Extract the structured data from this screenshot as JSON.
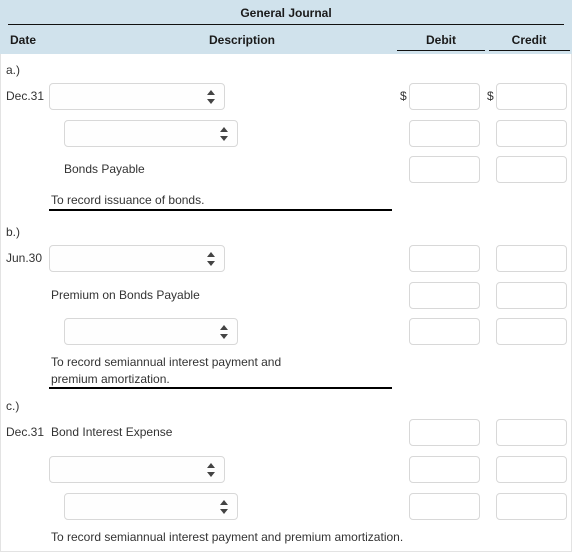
{
  "header": {
    "title": "General Journal",
    "columns": {
      "date": "Date",
      "description": "Description",
      "debit": "Debit",
      "credit": "Credit"
    }
  },
  "currency_symbol": "$",
  "select_placeholder": "",
  "amount_placeholder": "",
  "entries": [
    {
      "label": "a.)",
      "date": "Dec.31",
      "lines": [
        {
          "kind": "select",
          "value": "",
          "indent": 0,
          "debit": "",
          "credit": "",
          "show_currency": true
        },
        {
          "kind": "select",
          "value": "",
          "indent": 1,
          "debit": "",
          "credit": "",
          "show_currency": false
        },
        {
          "kind": "text",
          "value": "Bonds Payable",
          "indent": 1,
          "debit": "",
          "credit": "",
          "show_currency": false
        }
      ],
      "memo": "To record issuance of bonds."
    },
    {
      "label": "b.)",
      "date": "Jun.30",
      "lines": [
        {
          "kind": "select",
          "value": "",
          "indent": 0,
          "debit": "",
          "credit": "",
          "show_currency": false
        },
        {
          "kind": "text",
          "value": "Premium on Bonds Payable",
          "indent": 0,
          "debit": "",
          "credit": "",
          "show_currency": false
        },
        {
          "kind": "select",
          "value": "",
          "indent": 1,
          "debit": "",
          "credit": "",
          "show_currency": false
        }
      ],
      "memo": "To record semiannual interest payment and\npremium amortization."
    },
    {
      "label": "c.)",
      "date": "Dec.31",
      "lines": [
        {
          "kind": "text",
          "value": "Bond Interest Expense",
          "indent": 0,
          "debit": "",
          "credit": "",
          "show_currency": false
        },
        {
          "kind": "select",
          "value": "",
          "indent": 0,
          "debit": "",
          "credit": "",
          "show_currency": false
        },
        {
          "kind": "select",
          "value": "",
          "indent": 1,
          "debit": "",
          "credit": "",
          "show_currency": false
        }
      ],
      "memo": "To record semiannual interest payment and premium amortization."
    }
  ]
}
